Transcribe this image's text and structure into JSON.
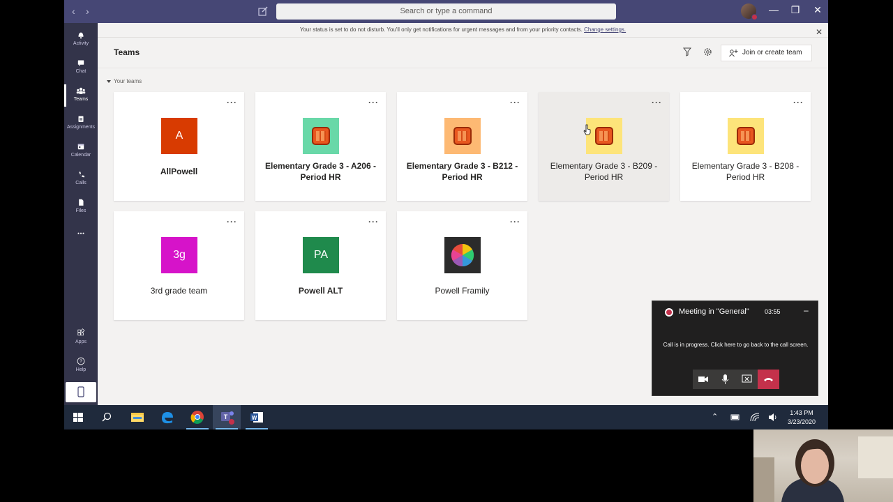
{
  "titlebar": {
    "search_placeholder": "Search or type a command",
    "back": "‹",
    "forward": "›",
    "minimize": "—",
    "maximize": "❐",
    "close": "✕"
  },
  "rail": [
    {
      "label": "Activity",
      "icon": "bell-icon"
    },
    {
      "label": "Chat",
      "icon": "chat-icon"
    },
    {
      "label": "Teams",
      "icon": "teams-icon"
    },
    {
      "label": "Assignments",
      "icon": "assignments-icon"
    },
    {
      "label": "Calendar",
      "icon": "calendar-icon"
    },
    {
      "label": "Calls",
      "icon": "phone-icon"
    },
    {
      "label": "Files",
      "icon": "file-icon"
    },
    {
      "label": "Apps",
      "icon": "apps-icon"
    },
    {
      "label": "Help",
      "icon": "help-icon"
    }
  ],
  "banner": {
    "text": "Your status is set to do not disturb. You'll only get notifications for urgent messages and from your priority contacts. ",
    "link": "Change settings."
  },
  "header": {
    "title": "Teams",
    "join_label": "Join or create team"
  },
  "section": {
    "title": "Your teams"
  },
  "teams": [
    {
      "name": "AllPowell",
      "initials": "A",
      "color": "#d83b01"
    },
    {
      "name": "Elementary Grade 3 - A206 - Period HR",
      "color": "#69d8a8"
    },
    {
      "name": "Elementary Grade 3 - B212 - Period HR",
      "color": "#fdb973"
    },
    {
      "name": "Elementary Grade 3 - B209 - Period HR",
      "color": "#fde47a"
    },
    {
      "name": "Elementary Grade 3 - B208 - Period HR",
      "color": "#fde47a"
    },
    {
      "name": "3rd grade team",
      "initials": "3g",
      "color": "#d613c9"
    },
    {
      "name": "Powell ALT",
      "initials": "PA",
      "color": "#1f8a4c"
    },
    {
      "name": "Powell Framily",
      "color": "#2b2b2b"
    }
  ],
  "meeting": {
    "title": "Meeting in \"General\"",
    "time": "03:55",
    "message": "Call is in progress. Click here to go back to the call screen."
  },
  "taskbar": {
    "time": "1:43 PM",
    "date": "3/23/2020"
  },
  "colors": {
    "brand": "#464775",
    "rail": "#33344a",
    "dnd": "#c4314b"
  }
}
